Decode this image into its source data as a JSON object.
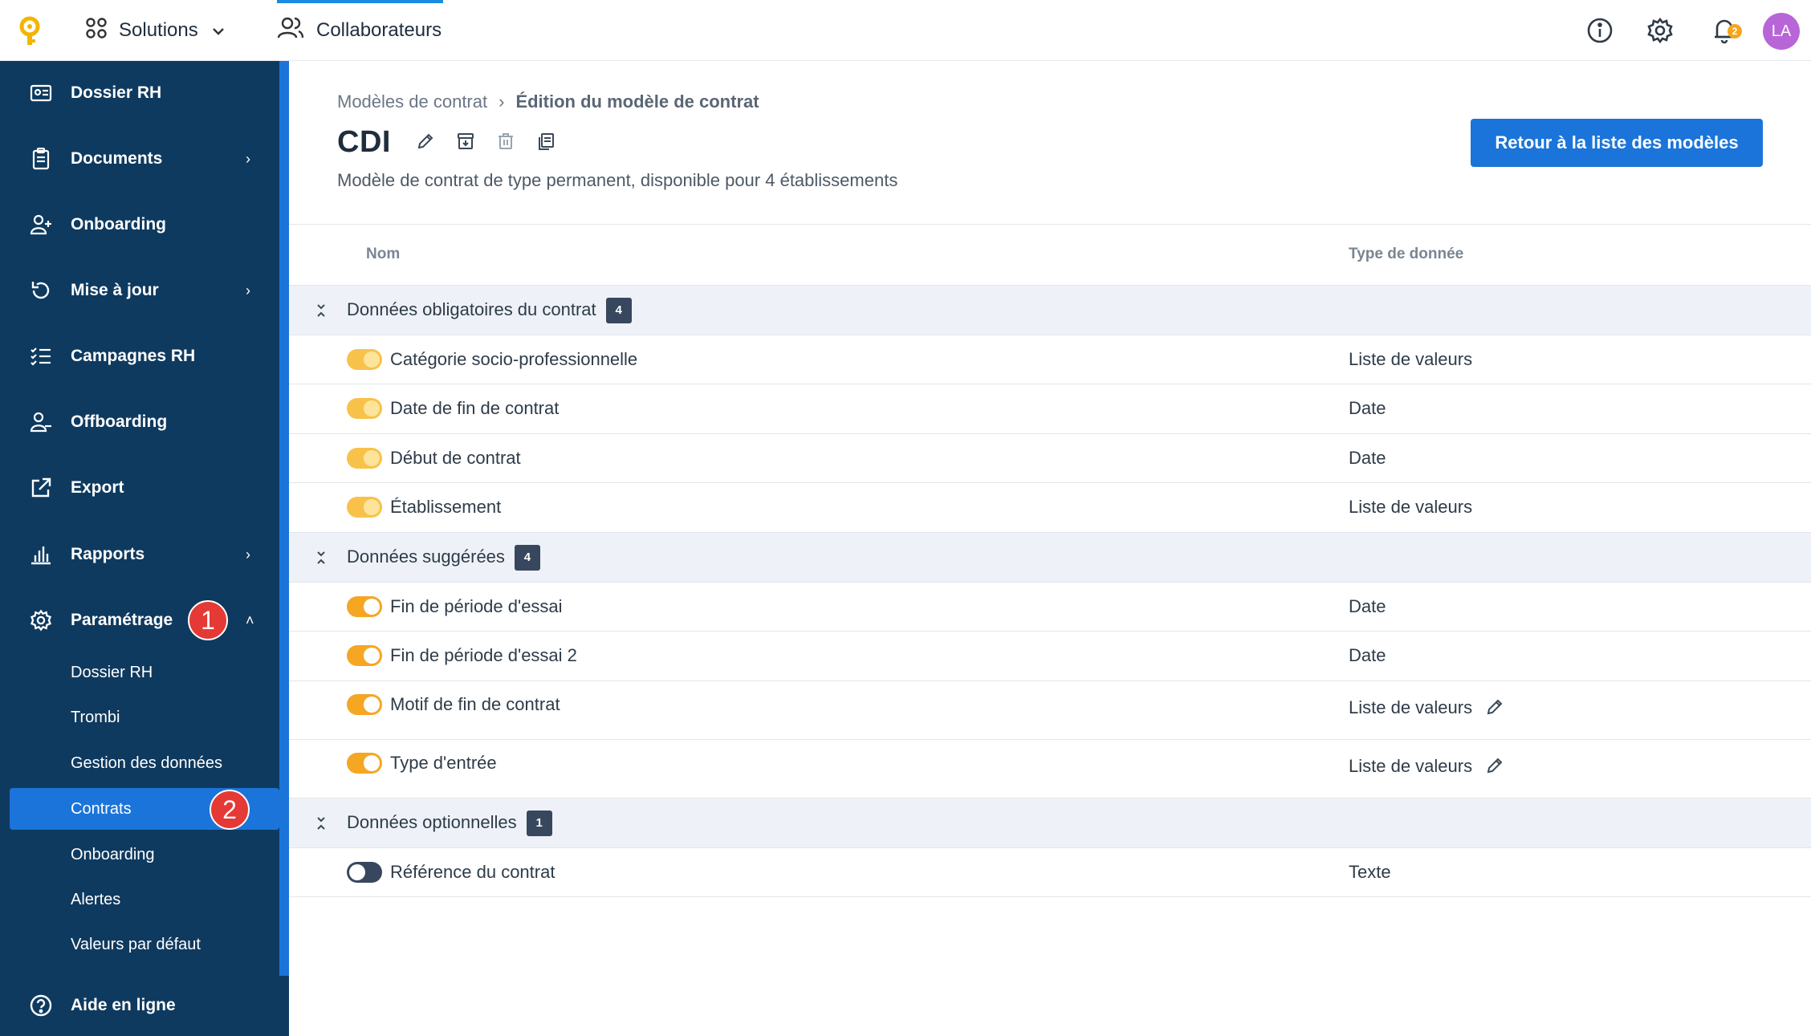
{
  "topbar": {
    "solutions_label": "Solutions",
    "collab_label": "Collaborateurs",
    "notif_count": "2",
    "avatar_initials": "LA"
  },
  "sidebar": {
    "items": [
      {
        "label": "Dossier RH",
        "icon": "id-card-icon"
      },
      {
        "label": "Documents",
        "icon": "clipboard-icon",
        "arrow": "›"
      },
      {
        "label": "Onboarding",
        "icon": "user-plus-icon"
      },
      {
        "label": "Mise à jour",
        "icon": "refresh-icon",
        "arrow": "›"
      },
      {
        "label": "Campagnes RH",
        "icon": "checklist-icon"
      },
      {
        "label": "Offboarding",
        "icon": "user-minus-icon"
      },
      {
        "label": "Export",
        "icon": "external-link-icon"
      },
      {
        "label": "Rapports",
        "icon": "bar-chart-icon",
        "arrow": "›"
      },
      {
        "label": "Paramétrage",
        "icon": "gear-icon",
        "arrow": "˄"
      }
    ],
    "sub_items": [
      "Dossier RH",
      "Trombi",
      "Gestion des données",
      "Contrats",
      "Onboarding",
      "Alertes",
      "Valeurs par défaut"
    ],
    "help_label": "Aide en ligne",
    "markers": [
      "1",
      "2"
    ]
  },
  "main": {
    "breadcrumb": {
      "parent": "Modèles de contrat",
      "sep": "›",
      "current": "Édition du modèle de contrat"
    },
    "title": "CDI",
    "subtitle": "Modèle de contrat de type permanent, disponible pour 4 établissements",
    "back_button": "Retour à la liste des modèles",
    "table": {
      "col_name": "Nom",
      "col_type": "Type de donnée",
      "groups": [
        {
          "label": "Données obligatoires du contrat",
          "count": "4",
          "rows": [
            {
              "name": "Catégorie socio-professionnelle",
              "type": "Liste de valeurs"
            },
            {
              "name": "Date de fin de contrat",
              "type": "Date"
            },
            {
              "name": "Début de contrat",
              "type": "Date"
            },
            {
              "name": "Établissement",
              "type": "Liste de valeurs"
            }
          ]
        },
        {
          "label": "Données suggérées",
          "count": "4",
          "rows": [
            {
              "name": "Fin de période d'essai",
              "type": "Date"
            },
            {
              "name": "Fin de période d'essai 2",
              "type": "Date"
            },
            {
              "name": "Motif de fin de contrat",
              "type": "Liste de valeurs"
            },
            {
              "name": "Type d'entrée",
              "type": "Liste de valeurs"
            }
          ]
        },
        {
          "label": "Données optionnelles",
          "count": "1",
          "rows": [
            {
              "name": "Référence du contrat",
              "type": "Texte"
            }
          ]
        }
      ]
    }
  },
  "colors": {
    "sidebar_bg": "#0f3a5f",
    "accent": "#1b74d9",
    "toggle_on": "#f5a623",
    "toggle_off": "#37475d",
    "marker": "#e53935"
  }
}
